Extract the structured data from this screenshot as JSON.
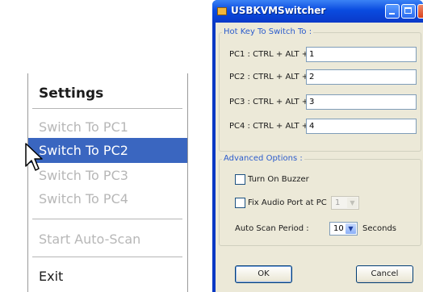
{
  "context_menu": {
    "title": "Settings",
    "items": [
      {
        "label": "Switch To PC1"
      },
      {
        "label": "Switch To PC2"
      },
      {
        "label": "Switch To PC3"
      },
      {
        "label": "Switch To PC4"
      },
      {
        "label": "Start Auto-Scan"
      },
      {
        "label": "Exit"
      }
    ],
    "selected_item": "Switch To PC2",
    "highlight_color": "#3a66c0"
  },
  "window": {
    "title": "USBKVMSwitcher",
    "title_bar_color": "#0a4be0",
    "hotkey_group": {
      "label": "Hot Key To Switch To :",
      "rows": [
        {
          "label": "PC1 : CTRL + ALT +",
          "value": "1"
        },
        {
          "label": "PC2 : CTRL + ALT +",
          "value": "2"
        },
        {
          "label": "PC3 : CTRL + ALT +",
          "value": "3"
        },
        {
          "label": "PC4 : CTRL + ALT +",
          "value": "4"
        }
      ]
    },
    "advanced_group": {
      "label": "Advanced Options :",
      "buzzer_label": "Turn On Buzzer",
      "fix_audio_label": "Fix Audio Port at PC",
      "fix_audio_value": "1",
      "auto_scan_label": "Auto Scan Period :",
      "auto_scan_value": "10",
      "seconds_label": "Seconds"
    },
    "ok_label": "OK",
    "cancel_label": "Cancel"
  }
}
